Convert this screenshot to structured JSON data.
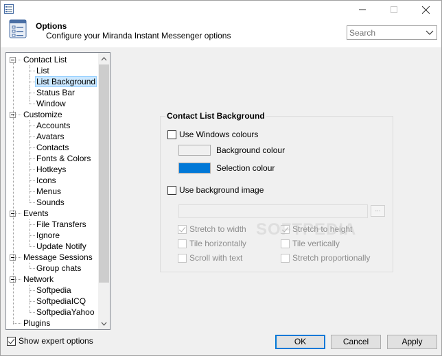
{
  "window": {
    "controls": {
      "minimize": "minimize-icon",
      "maximize": "maximize-icon",
      "close": "close-icon"
    }
  },
  "header": {
    "title": "Options",
    "subtitle": "Configure your Miranda Instant Messenger options",
    "icon": "options-checklist-icon"
  },
  "search": {
    "placeholder": "Search",
    "value": ""
  },
  "tree": {
    "items": [
      {
        "label": "Contact List",
        "level": 0,
        "expanded": true
      },
      {
        "label": "List",
        "level": 1
      },
      {
        "label": "List Background",
        "level": 1,
        "selected": true
      },
      {
        "label": "Status Bar",
        "level": 1
      },
      {
        "label": "Window",
        "level": 1
      },
      {
        "label": "Customize",
        "level": 0,
        "expanded": true
      },
      {
        "label": "Accounts",
        "level": 1
      },
      {
        "label": "Avatars",
        "level": 1
      },
      {
        "label": "Contacts",
        "level": 1
      },
      {
        "label": "Fonts & Colors",
        "level": 1
      },
      {
        "label": "Hotkeys",
        "level": 1
      },
      {
        "label": "Icons",
        "level": 1
      },
      {
        "label": "Menus",
        "level": 1
      },
      {
        "label": "Sounds",
        "level": 1
      },
      {
        "label": "Events",
        "level": 0,
        "expanded": true
      },
      {
        "label": "File Transfers",
        "level": 1
      },
      {
        "label": "Ignore",
        "level": 1
      },
      {
        "label": "Update Notify",
        "level": 1
      },
      {
        "label": "Message Sessions",
        "level": 0,
        "expanded": true
      },
      {
        "label": "Group chats",
        "level": 1
      },
      {
        "label": "Network",
        "level": 0,
        "expanded": true
      },
      {
        "label": "Softpedia",
        "level": 1
      },
      {
        "label": "SoftpediaICQ",
        "level": 1
      },
      {
        "label": "SoftpediaYahoo",
        "level": 1
      },
      {
        "label": "Plugins",
        "level": 0
      }
    ]
  },
  "panel": {
    "title": "Contact List Background",
    "use_windows_colours": "Use Windows colours",
    "background_colour": "Background colour",
    "selection_colour": "Selection colour",
    "background_swatch": "#f0f0f0",
    "selection_swatch": "#0078d7",
    "use_background_image": "Use background image",
    "image_path": "",
    "browse": "...",
    "stretch_width": "Stretch to width",
    "stretch_height": "Stretch to height",
    "tile_h": "Tile horizontally",
    "tile_v": "Tile vertically",
    "scroll_text": "Scroll with text",
    "stretch_prop": "Stretch proportionally"
  },
  "watermark": "SOFTPEDIA",
  "footer": {
    "show_expert": "Show expert options",
    "ok": "OK",
    "cancel": "Cancel",
    "apply": "Apply"
  }
}
